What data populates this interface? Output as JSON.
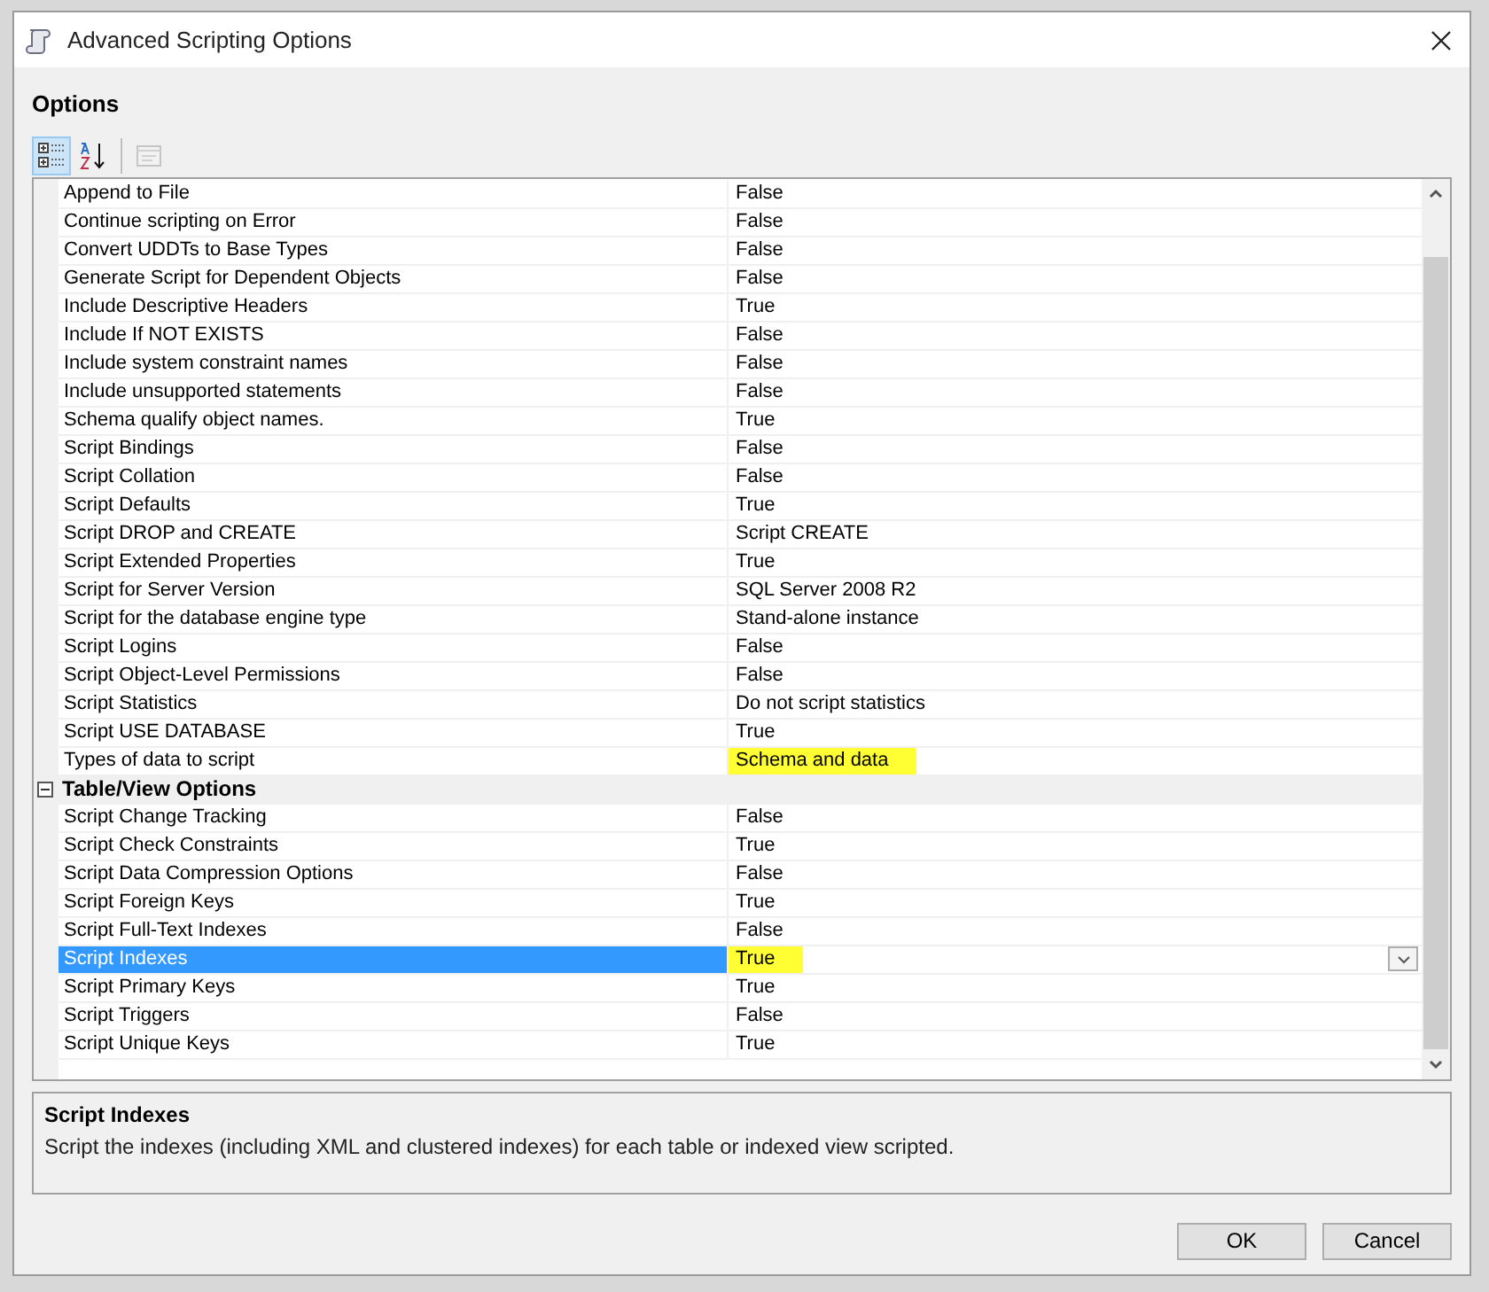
{
  "window": {
    "title": "Advanced Scripting Options"
  },
  "section_title": "Options",
  "toolbar": [
    {
      "kind": "categorized",
      "selected": true,
      "disabled": false
    },
    {
      "kind": "alphabetical",
      "selected": false,
      "disabled": false
    },
    {
      "kind": "property_pages",
      "selected": false,
      "disabled": true
    }
  ],
  "groups": [
    {
      "items": [
        {
          "name": "Append to File",
          "value": "False",
          "selected": false,
          "highlighted": false
        },
        {
          "name": "Continue scripting on Error",
          "value": "False",
          "selected": false,
          "highlighted": false
        },
        {
          "name": "Convert UDDTs to Base Types",
          "value": "False",
          "selected": false,
          "highlighted": false
        },
        {
          "name": "Generate Script for Dependent Objects",
          "value": "False",
          "selected": false,
          "highlighted": false
        },
        {
          "name": "Include Descriptive Headers",
          "value": "True",
          "selected": false,
          "highlighted": false
        },
        {
          "name": "Include If NOT EXISTS",
          "value": "False",
          "selected": false,
          "highlighted": false
        },
        {
          "name": "Include system constraint names",
          "value": "False",
          "selected": false,
          "highlighted": false
        },
        {
          "name": "Include unsupported statements",
          "value": "False",
          "selected": false,
          "highlighted": false
        },
        {
          "name": "Schema qualify object names.",
          "value": "True",
          "selected": false,
          "highlighted": false
        },
        {
          "name": "Script Bindings",
          "value": "False",
          "selected": false,
          "highlighted": false
        },
        {
          "name": "Script Collation",
          "value": "False",
          "selected": false,
          "highlighted": false
        },
        {
          "name": "Script Defaults",
          "value": "True",
          "selected": false,
          "highlighted": false
        },
        {
          "name": "Script DROP and CREATE",
          "value": "Script CREATE",
          "selected": false,
          "highlighted": false
        },
        {
          "name": "Script Extended Properties",
          "value": "True",
          "selected": false,
          "highlighted": false
        },
        {
          "name": "Script for Server Version",
          "value": "SQL Server 2008 R2",
          "selected": false,
          "highlighted": false
        },
        {
          "name": "Script for the database engine type",
          "value": "Stand-alone instance",
          "selected": false,
          "highlighted": false
        },
        {
          "name": "Script Logins",
          "value": "False",
          "selected": false,
          "highlighted": false
        },
        {
          "name": "Script Object-Level Permissions",
          "value": "False",
          "selected": false,
          "highlighted": false
        },
        {
          "name": "Script Statistics",
          "value": "Do not script statistics",
          "selected": false,
          "highlighted": false
        },
        {
          "name": "Script USE DATABASE",
          "value": "True",
          "selected": false,
          "highlighted": false
        },
        {
          "name": "Types of data to script",
          "value": "Schema and data",
          "selected": false,
          "highlighted": true
        }
      ]
    },
    {
      "title": "Table/View Options",
      "expanded": true,
      "items": [
        {
          "name": "Script Change Tracking",
          "value": "False",
          "selected": false,
          "highlighted": false
        },
        {
          "name": "Script Check Constraints",
          "value": "True",
          "selected": false,
          "highlighted": false
        },
        {
          "name": "Script Data Compression Options",
          "value": "False",
          "selected": false,
          "highlighted": false
        },
        {
          "name": "Script Foreign Keys",
          "value": "True",
          "selected": false,
          "highlighted": false
        },
        {
          "name": "Script Full-Text Indexes",
          "value": "False",
          "selected": false,
          "highlighted": false
        },
        {
          "name": "Script Indexes",
          "value": "True",
          "selected": true,
          "highlighted": true
        },
        {
          "name": "Script Primary Keys",
          "value": "True",
          "selected": false,
          "highlighted": false
        },
        {
          "name": "Script Triggers",
          "value": "False",
          "selected": false,
          "highlighted": false
        },
        {
          "name": "Script Unique Keys",
          "value": "True",
          "selected": false,
          "highlighted": false
        }
      ]
    }
  ],
  "description": {
    "title": "Script Indexes",
    "text": "Script the indexes (including XML and clustered indexes) for each table or indexed view scripted."
  },
  "buttons": [
    "OK",
    "Cancel"
  ]
}
